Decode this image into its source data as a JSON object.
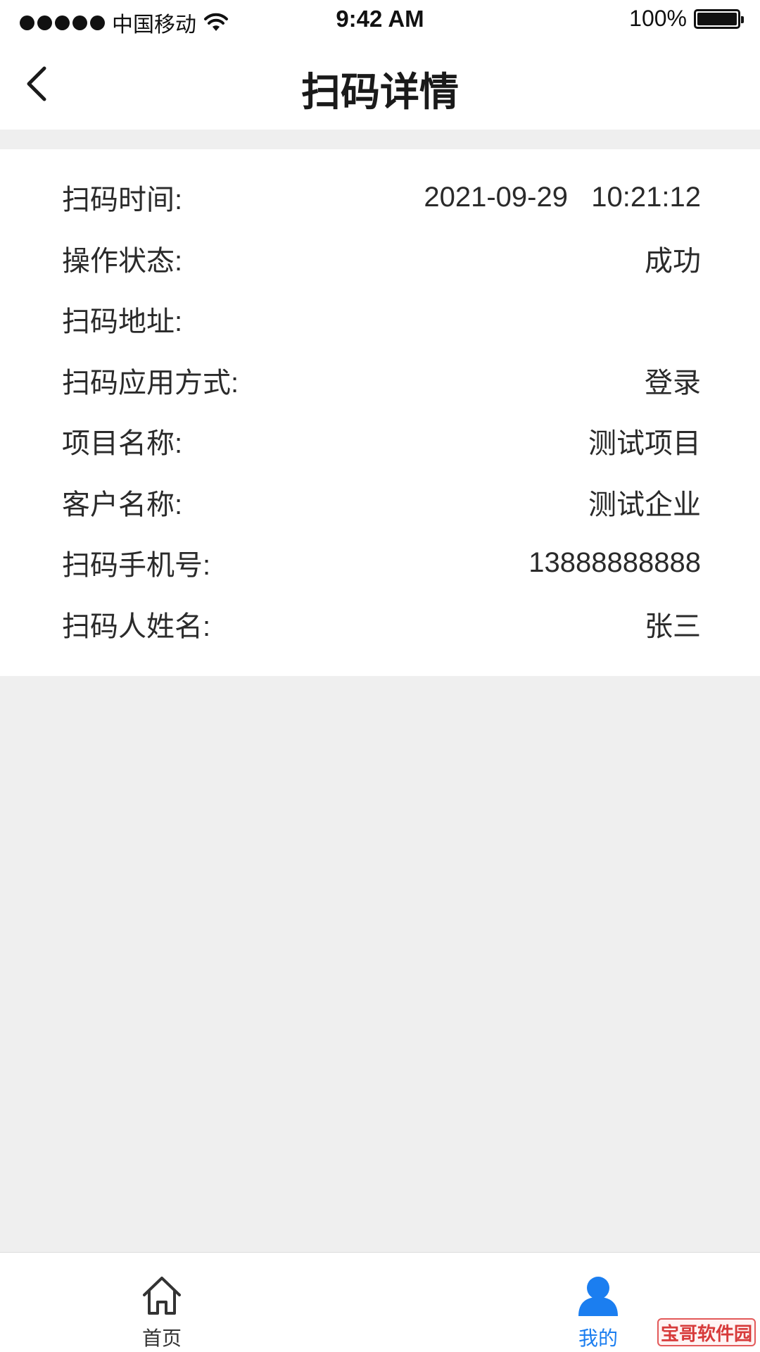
{
  "status_bar": {
    "carrier": "中国移动",
    "time": "9:42 AM",
    "battery": "100%"
  },
  "header": {
    "title": "扫码详情"
  },
  "details": [
    {
      "label": "扫码时间:",
      "value": "2021-09-29   10:21:12"
    },
    {
      "label": "操作状态:",
      "value": "成功"
    },
    {
      "label": "扫码地址:",
      "value": ""
    },
    {
      "label": "扫码应用方式:",
      "value": "登录"
    },
    {
      "label": "项目名称:",
      "value": "测试项目"
    },
    {
      "label": "客户名称:",
      "value": "测试企业"
    },
    {
      "label": "扫码手机号:",
      "value": "13888888888"
    },
    {
      "label": "扫码人姓名:",
      "value": "张三"
    }
  ],
  "tab_bar": {
    "home_label": "首页",
    "mine_label": "我的",
    "active": "mine",
    "active_color": "#1b7ef0"
  },
  "watermark": "宝哥软件园",
  "icons": {
    "back": "back-chevron-icon",
    "home": "home-icon",
    "mine": "person-icon",
    "wifi": "wifi-icon",
    "battery": "battery-icon"
  }
}
